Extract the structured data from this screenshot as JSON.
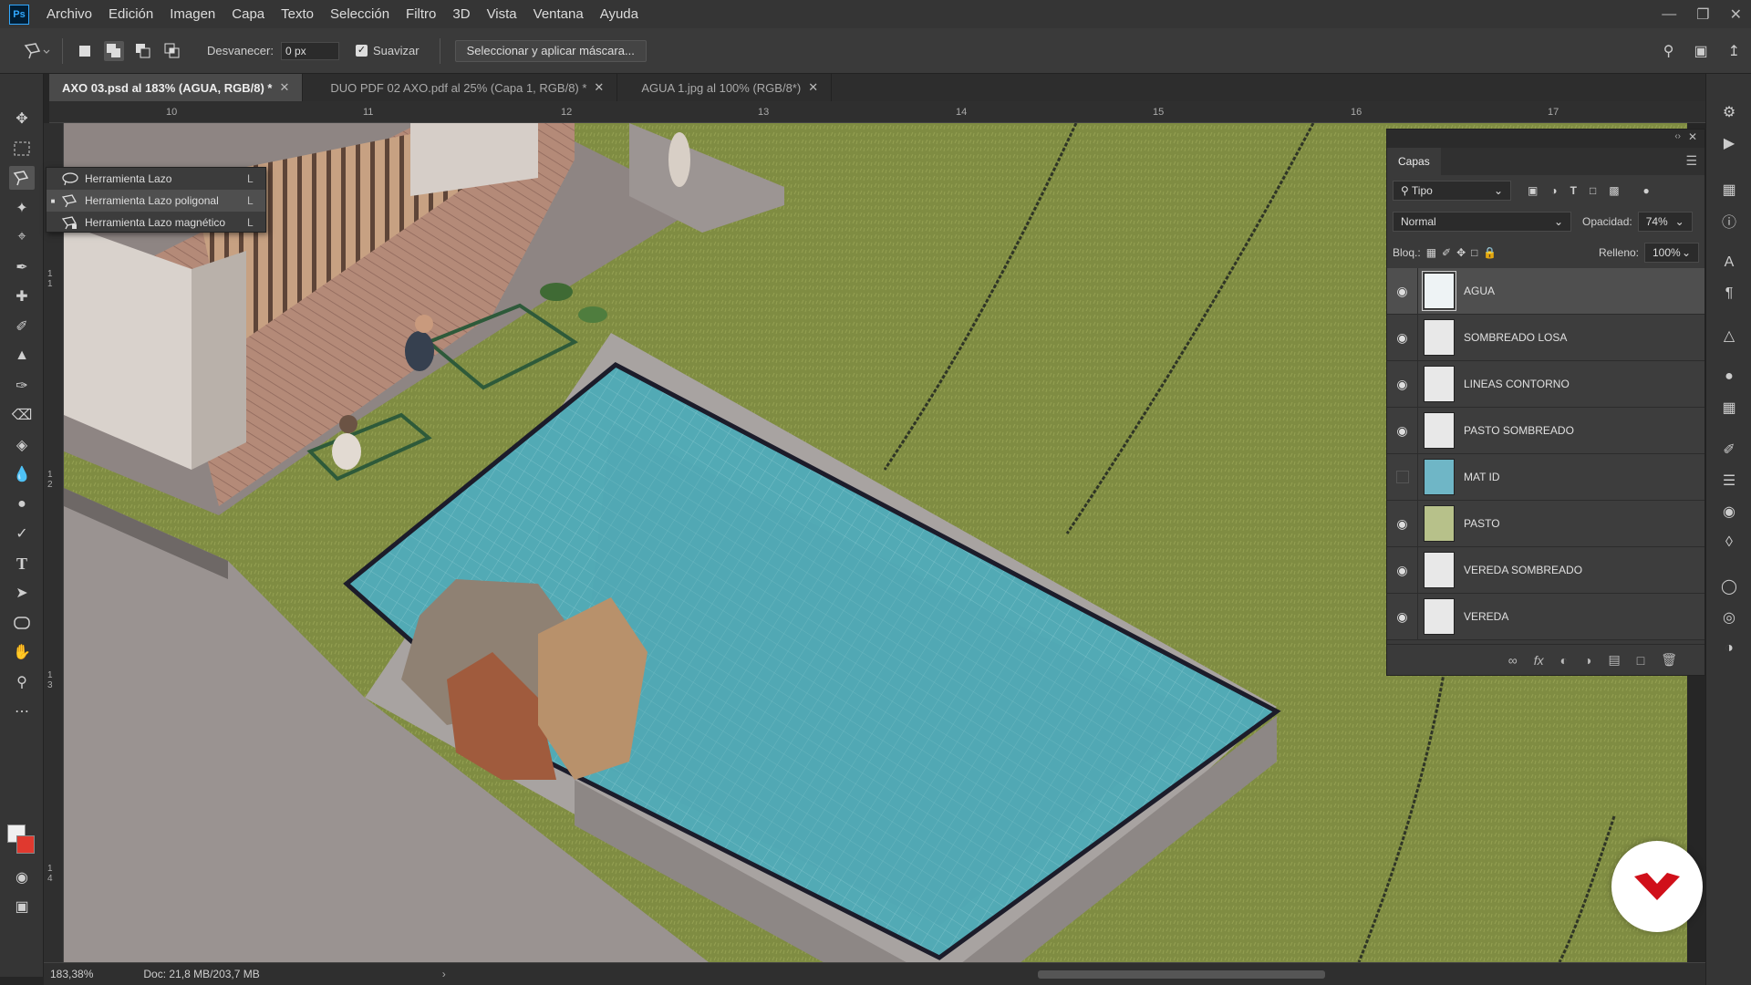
{
  "app": {
    "logo": "Ps"
  },
  "menu": [
    "Archivo",
    "Edición",
    "Imagen",
    "Capa",
    "Texto",
    "Selección",
    "Filtro",
    "3D",
    "Vista",
    "Ventana",
    "Ayuda"
  ],
  "options": {
    "feather_label": "Desvanecer:",
    "feather_value": "0 px",
    "smooth_label": "Suavizar",
    "smooth_checked": true,
    "mask_button": "Seleccionar y aplicar máscara..."
  },
  "tabs": [
    {
      "label": "AXO 03.psd al 183% (AGUA, RGB/8) *",
      "active": true
    },
    {
      "label": "DUO PDF 02 AXO.pdf al 25% (Capa 1, RGB/8) *",
      "active": false
    },
    {
      "label": "AGUA 1.jpg al 100% (RGB/8*)",
      "active": false
    }
  ],
  "ruler": {
    "top": [
      "10",
      "11",
      "12",
      "13",
      "14",
      "15",
      "16",
      "17"
    ],
    "left": [
      "1 1",
      "1 2",
      "1 3",
      "1 4"
    ]
  },
  "flyout": {
    "items": [
      {
        "label": "Herramienta Lazo",
        "key": "L",
        "selected": false
      },
      {
        "label": "Herramienta Lazo poligonal",
        "key": "L",
        "selected": true
      },
      {
        "label": "Herramienta Lazo magnético",
        "key": "L",
        "selected": false
      }
    ]
  },
  "layers_panel": {
    "title": "Capas",
    "filter": "Tipo",
    "blend_mode": "Normal",
    "opacity_label": "Opacidad:",
    "opacity_value": "74%",
    "lock_label": "Bloq.:",
    "fill_label": "Relleno:",
    "fill_value": "100%",
    "layers": [
      {
        "name": "AGUA",
        "visible": true,
        "selected": true,
        "thumb": "#eef3f5"
      },
      {
        "name": "SOMBREADO LOSA",
        "visible": true,
        "selected": false,
        "thumb": "#ededed"
      },
      {
        "name": "LINEAS CONTORNO",
        "visible": true,
        "selected": false,
        "thumb": "#ededed"
      },
      {
        "name": "PASTO SOMBREADO",
        "visible": true,
        "selected": false,
        "thumb": "#ededed"
      },
      {
        "name": "MAT ID",
        "visible": false,
        "selected": false,
        "thumb": "#6fb6c6"
      },
      {
        "name": "PASTO",
        "visible": true,
        "selected": false,
        "thumb": "#b7c18a"
      },
      {
        "name": "VEREDA SOMBREADO",
        "visible": true,
        "selected": false,
        "thumb": "#ededed"
      },
      {
        "name": "VEREDA",
        "visible": true,
        "selected": false,
        "thumb": "#ededed"
      }
    ]
  },
  "status": {
    "zoom": "183,38%",
    "doc": "Doc: 21,8 MB/203,7 MB"
  },
  "colors": {
    "foreground": "#f0f0f0",
    "background": "#e0392f",
    "pool": "#4fa7b3",
    "grass": "#7f8c42",
    "brand": "#d0101a"
  },
  "icons": {
    "toolbar": [
      "move-icon",
      "marquee-icon",
      "polygonal-lasso-icon",
      "magic-wand-icon",
      "crop-icon",
      "eyedropper-icon",
      "healing-brush-icon",
      "brush-icon",
      "clone-stamp-icon",
      "history-brush-icon",
      "eraser-icon",
      "paint-bucket-icon",
      "blur-icon",
      "dodge-icon",
      "pen-icon",
      "type-icon",
      "path-selection-icon",
      "rectangle-shape-icon",
      "hand-icon",
      "zoom-icon",
      "more-tools-icon"
    ]
  }
}
